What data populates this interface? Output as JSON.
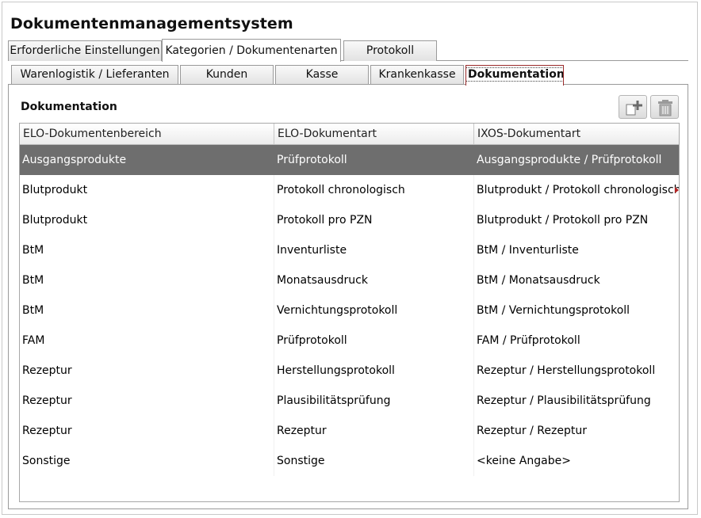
{
  "app": {
    "title": "Dokumentenmanagementsystem"
  },
  "main_tabs": [
    {
      "label": "Erforderliche Einstellungen",
      "selected": false
    },
    {
      "label": "Kategorien / Dokumentenarten",
      "selected": true
    },
    {
      "label": "Protokoll",
      "selected": false
    }
  ],
  "sub_tabs": [
    {
      "label": "Warenlogistik / Lieferanten",
      "selected": false
    },
    {
      "label": "Kunden",
      "selected": false
    },
    {
      "label": "Kasse",
      "selected": false
    },
    {
      "label": "Krankenkasse",
      "selected": false
    },
    {
      "label": "Dokumentation",
      "selected": true
    }
  ],
  "section": {
    "title": "Dokumentation",
    "buttons": [
      {
        "name": "add-document-button",
        "icon": "add-document-icon",
        "enabled": true
      },
      {
        "name": "delete-button",
        "icon": "trash-icon",
        "enabled": false
      }
    ]
  },
  "table": {
    "columns": [
      "ELO-Dokumentenbereich",
      "ELO-Dokumentart",
      "IXOS-Dokumentart"
    ],
    "selected_row": 0,
    "rows": [
      [
        "Ausgangsprodukte",
        "Prüfprotokoll",
        "Ausgangsprodukte / Prüfprotokoll"
      ],
      [
        "Blutprodukt",
        "Protokoll chronologisch",
        "Blutprodukt / Protokoll chronologisch"
      ],
      [
        "Blutprodukt",
        "Protokoll pro PZN",
        "Blutprodukt / Protokoll pro PZN"
      ],
      [
        "BtM",
        "Inventurliste",
        "BtM / Inventurliste"
      ],
      [
        "BtM",
        "Monatsausdruck",
        "BtM / Monatsausdruck"
      ],
      [
        "BtM",
        "Vernichtungsprotokoll",
        "BtM / Vernichtungsprotokoll"
      ],
      [
        "FAM",
        "Prüfprotokoll",
        "FAM / Prüfprotokoll"
      ],
      [
        "Rezeptur",
        "Herstellungsprotokoll",
        "Rezeptur / Herstellungsprotokoll"
      ],
      [
        "Rezeptur",
        "Plausibilitätsprüfung",
        "Rezeptur / Plausibilitätsprüfung"
      ],
      [
        "Rezeptur",
        "Rezeptur",
        "Rezeptur / Rezeptur"
      ],
      [
        "Sonstige",
        "Sonstige",
        "<keine Angabe>"
      ]
    ]
  }
}
